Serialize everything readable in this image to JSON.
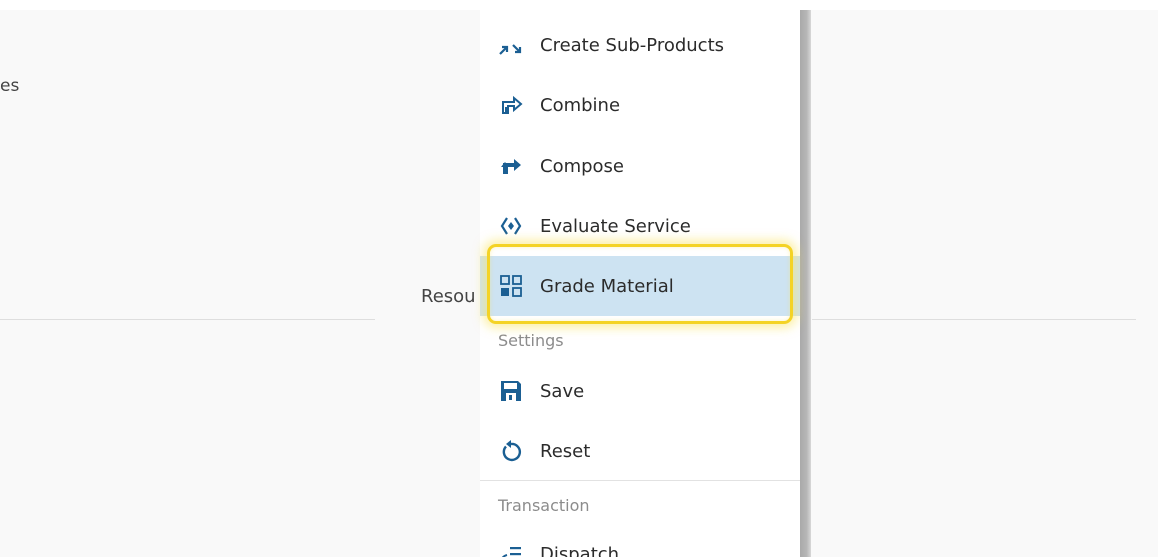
{
  "background": {
    "left_fragment": "es",
    "label_fragment": "Resou"
  },
  "menu": {
    "items": [
      {
        "label": "Create Sub-Products",
        "icon": "arrows-collapse-icon"
      },
      {
        "label": "Combine",
        "icon": "combine-icon"
      },
      {
        "label": "Compose",
        "icon": "compose-icon"
      },
      {
        "label": "Evaluate Service",
        "icon": "evaluate-icon"
      },
      {
        "label": "Grade Material",
        "icon": "grade-grid-icon",
        "selected": true
      }
    ],
    "settings": {
      "header": "Settings",
      "items": [
        {
          "label": "Save",
          "icon": "save-icon"
        },
        {
          "label": "Reset",
          "icon": "reset-icon"
        }
      ]
    },
    "transaction": {
      "header": "Transaction",
      "items": [
        {
          "label": "Dispatch",
          "icon": "dispatch-icon"
        }
      ]
    }
  },
  "colors": {
    "icon_blue": "#1b5f93",
    "selected_bg": "#cde3f2",
    "highlight_border": "#f4d325"
  }
}
